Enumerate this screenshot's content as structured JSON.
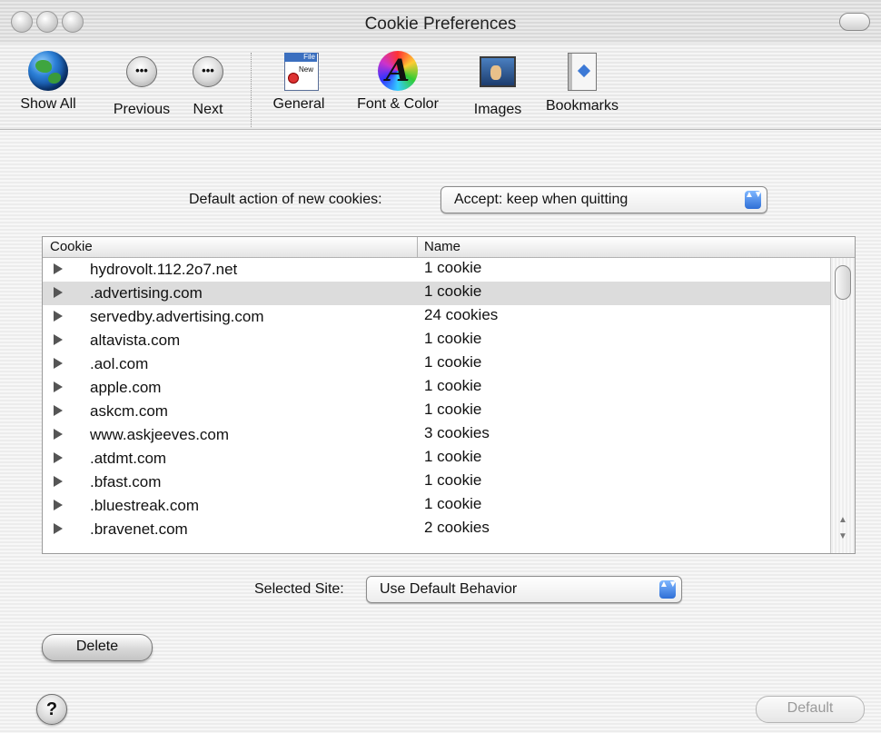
{
  "window": {
    "title": "Cookie Preferences"
  },
  "toolbar": {
    "items": [
      {
        "label": "Show All",
        "icon": "globe-icon"
      },
      {
        "label": "Previous",
        "icon": "previous-icon",
        "glyph": "•••"
      },
      {
        "label": "Next",
        "icon": "next-icon",
        "glyph": "•••"
      },
      {
        "label": "General",
        "icon": "general-icon",
        "bar_text": "File",
        "new_text": "New"
      },
      {
        "label": "Font & Color",
        "icon": "font-color-icon",
        "glyph": "A"
      },
      {
        "label": "Images",
        "icon": "images-icon"
      },
      {
        "label": "Bookmarks",
        "icon": "bookmarks-icon"
      }
    ]
  },
  "default_action": {
    "label": "Default action of new cookies:",
    "value": "Accept: keep when quitting",
    "arrows": "▲▼"
  },
  "table": {
    "columns": [
      "Cookie",
      "Name"
    ],
    "rows": [
      {
        "site": "hydrovolt.112.2o7.net",
        "count": "1 cookie",
        "selected": false
      },
      {
        "site": ".advertising.com",
        "count": "1 cookie",
        "selected": true
      },
      {
        "site": "servedby.advertising.com",
        "count": "24 cookies",
        "selected": false
      },
      {
        "site": "altavista.com",
        "count": "1 cookie",
        "selected": false
      },
      {
        "site": ".aol.com",
        "count": "1 cookie",
        "selected": false
      },
      {
        "site": "apple.com",
        "count": "1 cookie",
        "selected": false
      },
      {
        "site": "askcm.com",
        "count": "1 cookie",
        "selected": false
      },
      {
        "site": "www.askjeeves.com",
        "count": "3 cookies",
        "selected": false
      },
      {
        "site": ".atdmt.com",
        "count": "1 cookie",
        "selected": false
      },
      {
        "site": ".bfast.com",
        "count": "1 cookie",
        "selected": false
      },
      {
        "site": ".bluestreak.com",
        "count": "1 cookie",
        "selected": false
      },
      {
        "site": ".bravenet.com",
        "count": "2 cookies",
        "selected": false
      }
    ],
    "scroll_up": "▲",
    "scroll_down": "▼"
  },
  "selected_site": {
    "label": "Selected Site:",
    "value": "Use Default Behavior",
    "arrows": "▲▼"
  },
  "buttons": {
    "delete": "Delete",
    "default": "Default",
    "help": "?"
  },
  "colors": {
    "selection": "#dcdcdc",
    "popup_arrows": "#2f6fd6"
  }
}
